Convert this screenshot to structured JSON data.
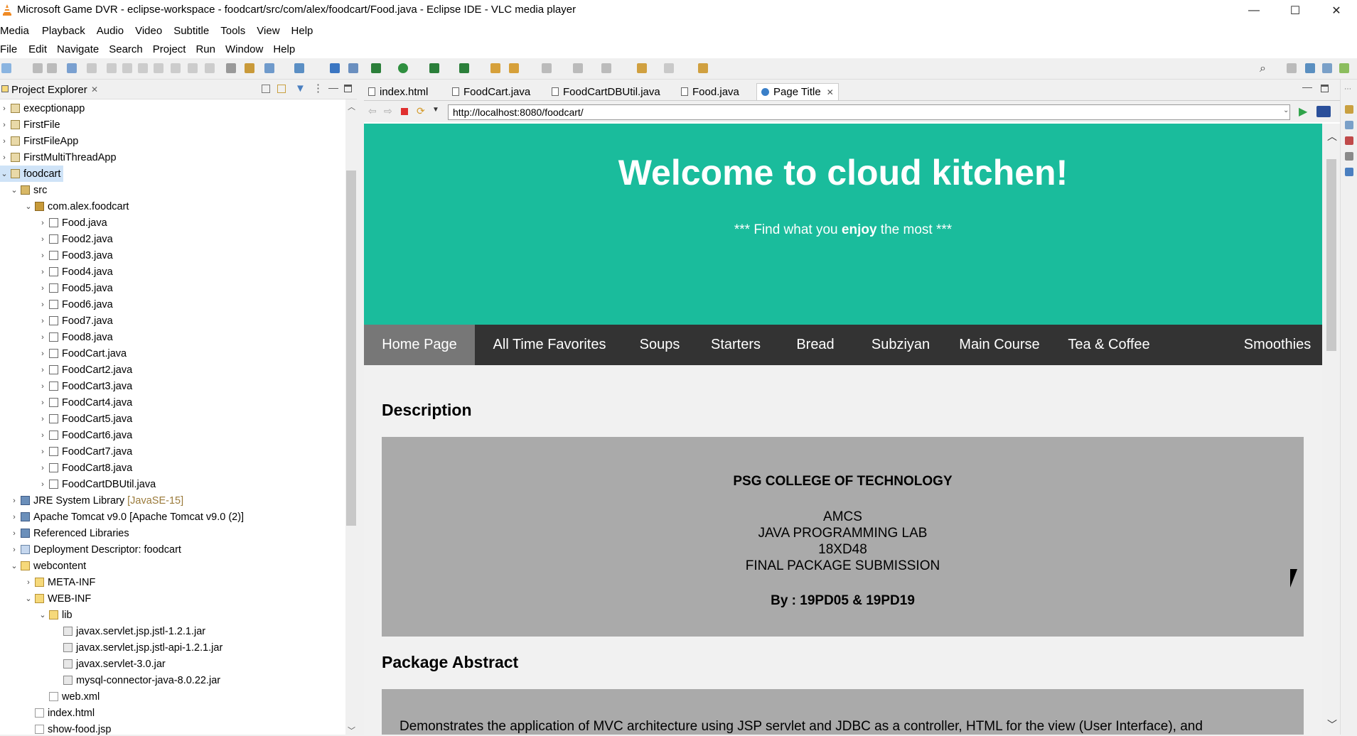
{
  "window": {
    "title": "Microsoft Game DVR - eclipse-workspace - foodcart/src/com/alex/foodcart/Food.java - Eclipse IDE - VLC media player",
    "controls": {
      "minimize": "—",
      "maximize": "☐",
      "close": "✕"
    }
  },
  "vlc_menu": [
    "Media",
    "Playback",
    "Audio",
    "Video",
    "Subtitle",
    "Tools",
    "View",
    "Help"
  ],
  "eclipse_menu": [
    "File",
    "Edit",
    "Navigate",
    "Search",
    "Project",
    "Run",
    "Window",
    "Help"
  ],
  "project_explorer": {
    "title": "Project Explorer",
    "close_glyph": "✕",
    "tree": [
      {
        "label": "execptionapp",
        "depth": 0,
        "chev": "›",
        "icon": "proj"
      },
      {
        "label": "FirstFile",
        "depth": 0,
        "chev": "›",
        "icon": "proj"
      },
      {
        "label": "FirstFileApp",
        "depth": 0,
        "chev": "›",
        "icon": "proj"
      },
      {
        "label": "FirstMultiThreadApp",
        "depth": 0,
        "chev": "›",
        "icon": "proj"
      },
      {
        "label": "foodcart",
        "depth": 0,
        "chev": "⌄",
        "icon": "proj",
        "selected": true
      },
      {
        "label": "src",
        "depth": 1,
        "chev": "⌄",
        "icon": "src"
      },
      {
        "label": "com.alex.foodcart",
        "depth": 2,
        "chev": "⌄",
        "icon": "pkg"
      },
      {
        "label": "Food.java",
        "depth": 3,
        "chev": "›",
        "icon": "java"
      },
      {
        "label": "Food2.java",
        "depth": 3,
        "chev": "›",
        "icon": "java"
      },
      {
        "label": "Food3.java",
        "depth": 3,
        "chev": "›",
        "icon": "java"
      },
      {
        "label": "Food4.java",
        "depth": 3,
        "chev": "›",
        "icon": "java"
      },
      {
        "label": "Food5.java",
        "depth": 3,
        "chev": "›",
        "icon": "java"
      },
      {
        "label": "Food6.java",
        "depth": 3,
        "chev": "›",
        "icon": "java"
      },
      {
        "label": "Food7.java",
        "depth": 3,
        "chev": "›",
        "icon": "java"
      },
      {
        "label": "Food8.java",
        "depth": 3,
        "chev": "›",
        "icon": "java"
      },
      {
        "label": "FoodCart.java",
        "depth": 3,
        "chev": "›",
        "icon": "java"
      },
      {
        "label": "FoodCart2.java",
        "depth": 3,
        "chev": "›",
        "icon": "java"
      },
      {
        "label": "FoodCart3.java",
        "depth": 3,
        "chev": "›",
        "icon": "java"
      },
      {
        "label": "FoodCart4.java",
        "depth": 3,
        "chev": "›",
        "icon": "java"
      },
      {
        "label": "FoodCart5.java",
        "depth": 3,
        "chev": "›",
        "icon": "java"
      },
      {
        "label": "FoodCart6.java",
        "depth": 3,
        "chev": "›",
        "icon": "java"
      },
      {
        "label": "FoodCart7.java",
        "depth": 3,
        "chev": "›",
        "icon": "java"
      },
      {
        "label": "FoodCart8.java",
        "depth": 3,
        "chev": "›",
        "icon": "java"
      },
      {
        "label": "FoodCartDBUtil.java",
        "depth": 3,
        "chev": "›",
        "icon": "java"
      },
      {
        "label": "JRE System Library",
        "suffix": "[JavaSE-15]",
        "depth": 1,
        "chev": "›",
        "icon": "lib"
      },
      {
        "label": "Apache Tomcat v9.0 [Apache Tomcat v9.0 (2)]",
        "depth": 1,
        "chev": "›",
        "icon": "lib"
      },
      {
        "label": "Referenced Libraries",
        "depth": 1,
        "chev": "›",
        "icon": "lib"
      },
      {
        "label": "Deployment Descriptor: foodcart",
        "depth": 1,
        "chev": "›",
        "icon": "dd"
      },
      {
        "label": "webcontent",
        "depth": 1,
        "chev": "⌄",
        "icon": "folder"
      },
      {
        "label": "META-INF",
        "depth": 2,
        "chev": "›",
        "icon": "folder"
      },
      {
        "label": "WEB-INF",
        "depth": 2,
        "chev": "⌄",
        "icon": "folder"
      },
      {
        "label": "lib",
        "depth": 3,
        "chev": "⌄",
        "icon": "folder"
      },
      {
        "label": "javax.servlet.jsp.jstl-1.2.1.jar",
        "depth": 4,
        "chev": "",
        "icon": "jar"
      },
      {
        "label": "javax.servlet.jsp.jstl-api-1.2.1.jar",
        "depth": 4,
        "chev": "",
        "icon": "jar"
      },
      {
        "label": "javax.servlet-3.0.jar",
        "depth": 4,
        "chev": "",
        "icon": "jar"
      },
      {
        "label": "mysql-connector-java-8.0.22.jar",
        "depth": 4,
        "chev": "",
        "icon": "jar"
      },
      {
        "label": "web.xml",
        "depth": 3,
        "chev": "",
        "icon": "xml"
      },
      {
        "label": "index.html",
        "depth": 2,
        "chev": "",
        "icon": "xml"
      },
      {
        "label": "show-food.jsp",
        "depth": 2,
        "chev": "",
        "icon": "xml"
      }
    ]
  },
  "editor_tabs": [
    {
      "label": "index.html"
    },
    {
      "label": "FoodCart.java"
    },
    {
      "label": "FoodCartDBUtil.java"
    },
    {
      "label": "Food.java"
    },
    {
      "label": "Page Title",
      "active": true,
      "close": "✕"
    }
  ],
  "browser": {
    "url": "http://localhost:8080/foodcart/"
  },
  "webpage": {
    "hero_title": "Welcome to cloud kitchen!",
    "tagline_pre": "*** Find what you ",
    "tagline_bold": "enjoy",
    "tagline_post": " the most ***",
    "nav": [
      "Home Page",
      "All Time Favorites",
      "Soups",
      "Starters",
      "Bread",
      "Subziyan",
      "Main Course",
      "Tea & Coffee",
      "Smoothies"
    ],
    "description_heading": "Description",
    "college": "PSG COLLEGE OF TECHNOLOGY",
    "dept": "AMCS",
    "lab": "JAVA PROGRAMMING LAB",
    "code": "18XD48",
    "submission": "FINAL PACKAGE SUBMISSION",
    "by": "By : 19PD05 & 19PD19",
    "abstract_heading": "Package Abstract",
    "abstract_text": "Demonstrates the application of MVC architecture using JSP servlet and JDBC as a controller, HTML for the view (User Interface), and"
  },
  "colors": {
    "hero": "#1abc9c",
    "nav": "#333333",
    "nav_active": "#777777",
    "box": "#aaaaaa"
  }
}
